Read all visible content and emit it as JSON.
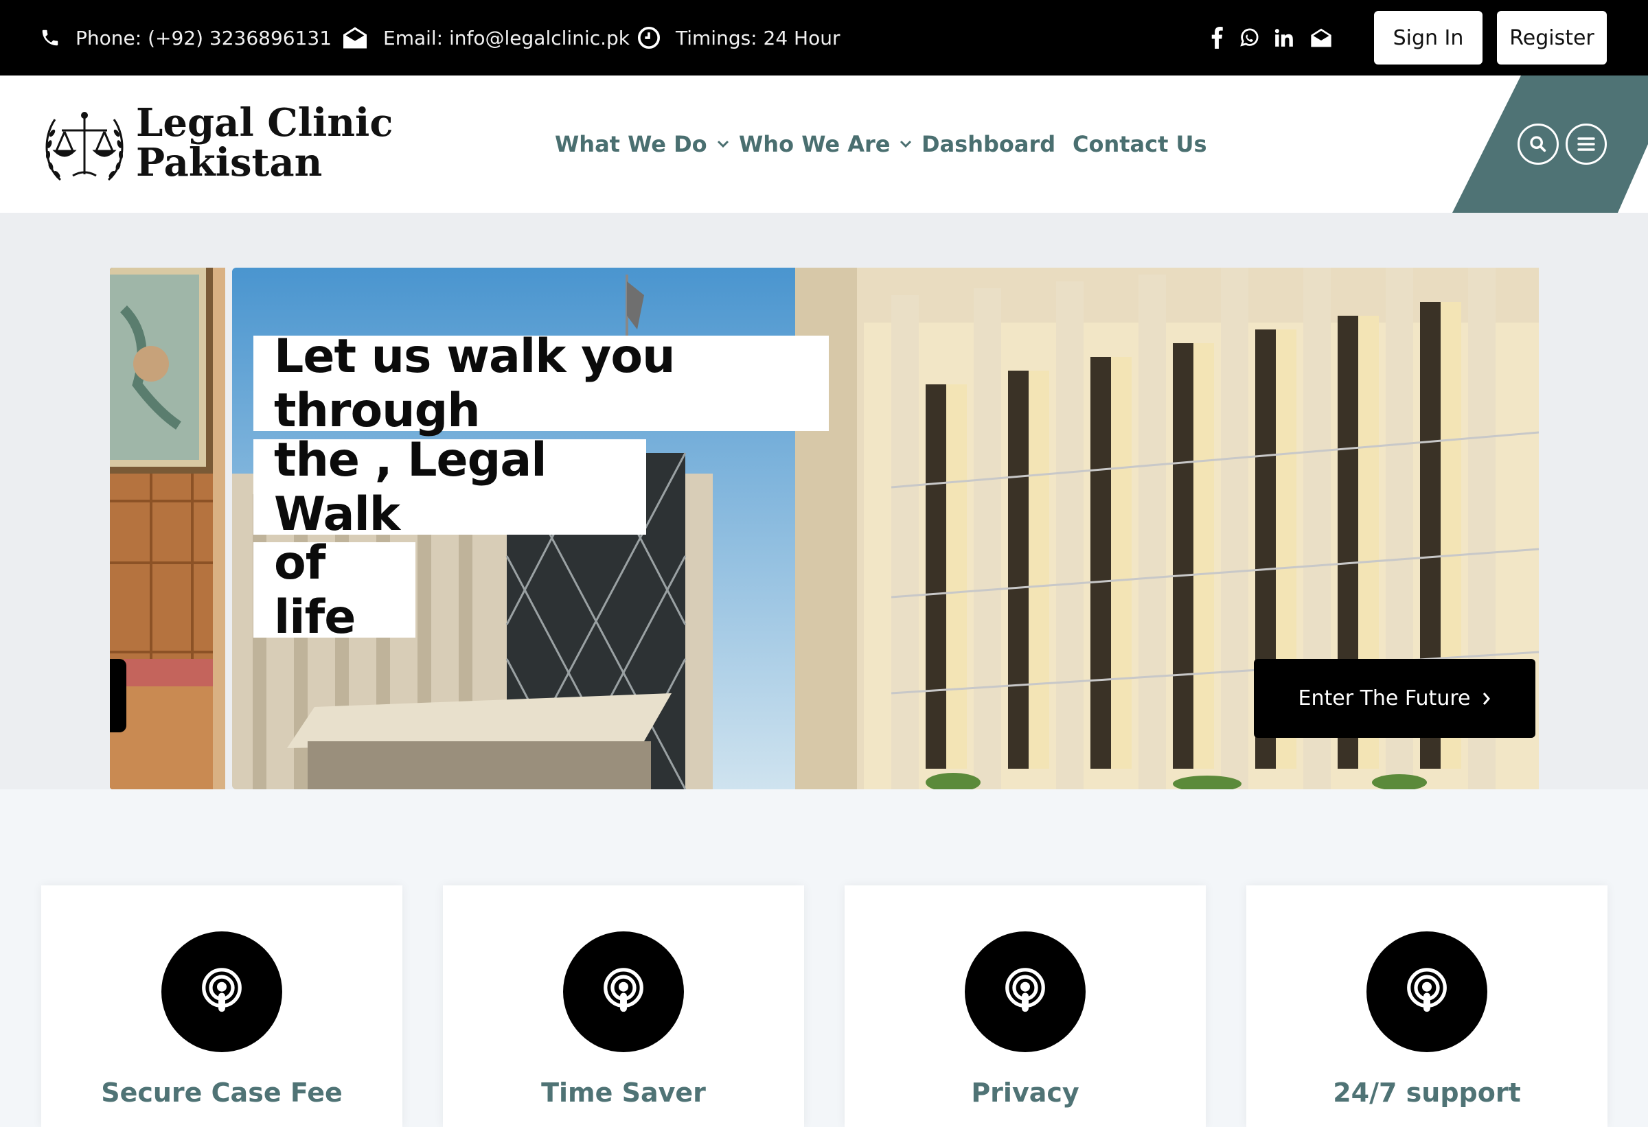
{
  "topbar": {
    "phone": "Phone: (+92) 3236896131",
    "email": "Email: info@legalclinic.pk",
    "timings": "Timings: 24 Hour",
    "social_icons": [
      "facebook-icon",
      "whatsapp-icon",
      "linkedin-icon",
      "envelope-icon"
    ],
    "sign_in": "Sign In",
    "register": "Register"
  },
  "header": {
    "logo_line1": "Legal Clinic",
    "logo_line2": "Pakistan",
    "nav": [
      {
        "label": "What We Do",
        "has_dropdown": true
      },
      {
        "label": "Who We Are",
        "has_dropdown": true
      },
      {
        "label": "Dashboard",
        "has_dropdown": false
      },
      {
        "label": "Contact Us",
        "has_dropdown": false
      }
    ],
    "accent_color": "#4f7375"
  },
  "hero": {
    "lines": [
      "Let us walk you through",
      "the , Legal Walk",
      "of life"
    ],
    "cta": "Enter The Future"
  },
  "features": [
    {
      "title": "Secure Case Fee",
      "icon": "podcast-icon"
    },
    {
      "title": "Time Saver",
      "icon": "podcast-icon"
    },
    {
      "title": "Privacy",
      "icon": "podcast-icon"
    },
    {
      "title": "24/7 support",
      "icon": "podcast-icon"
    }
  ]
}
